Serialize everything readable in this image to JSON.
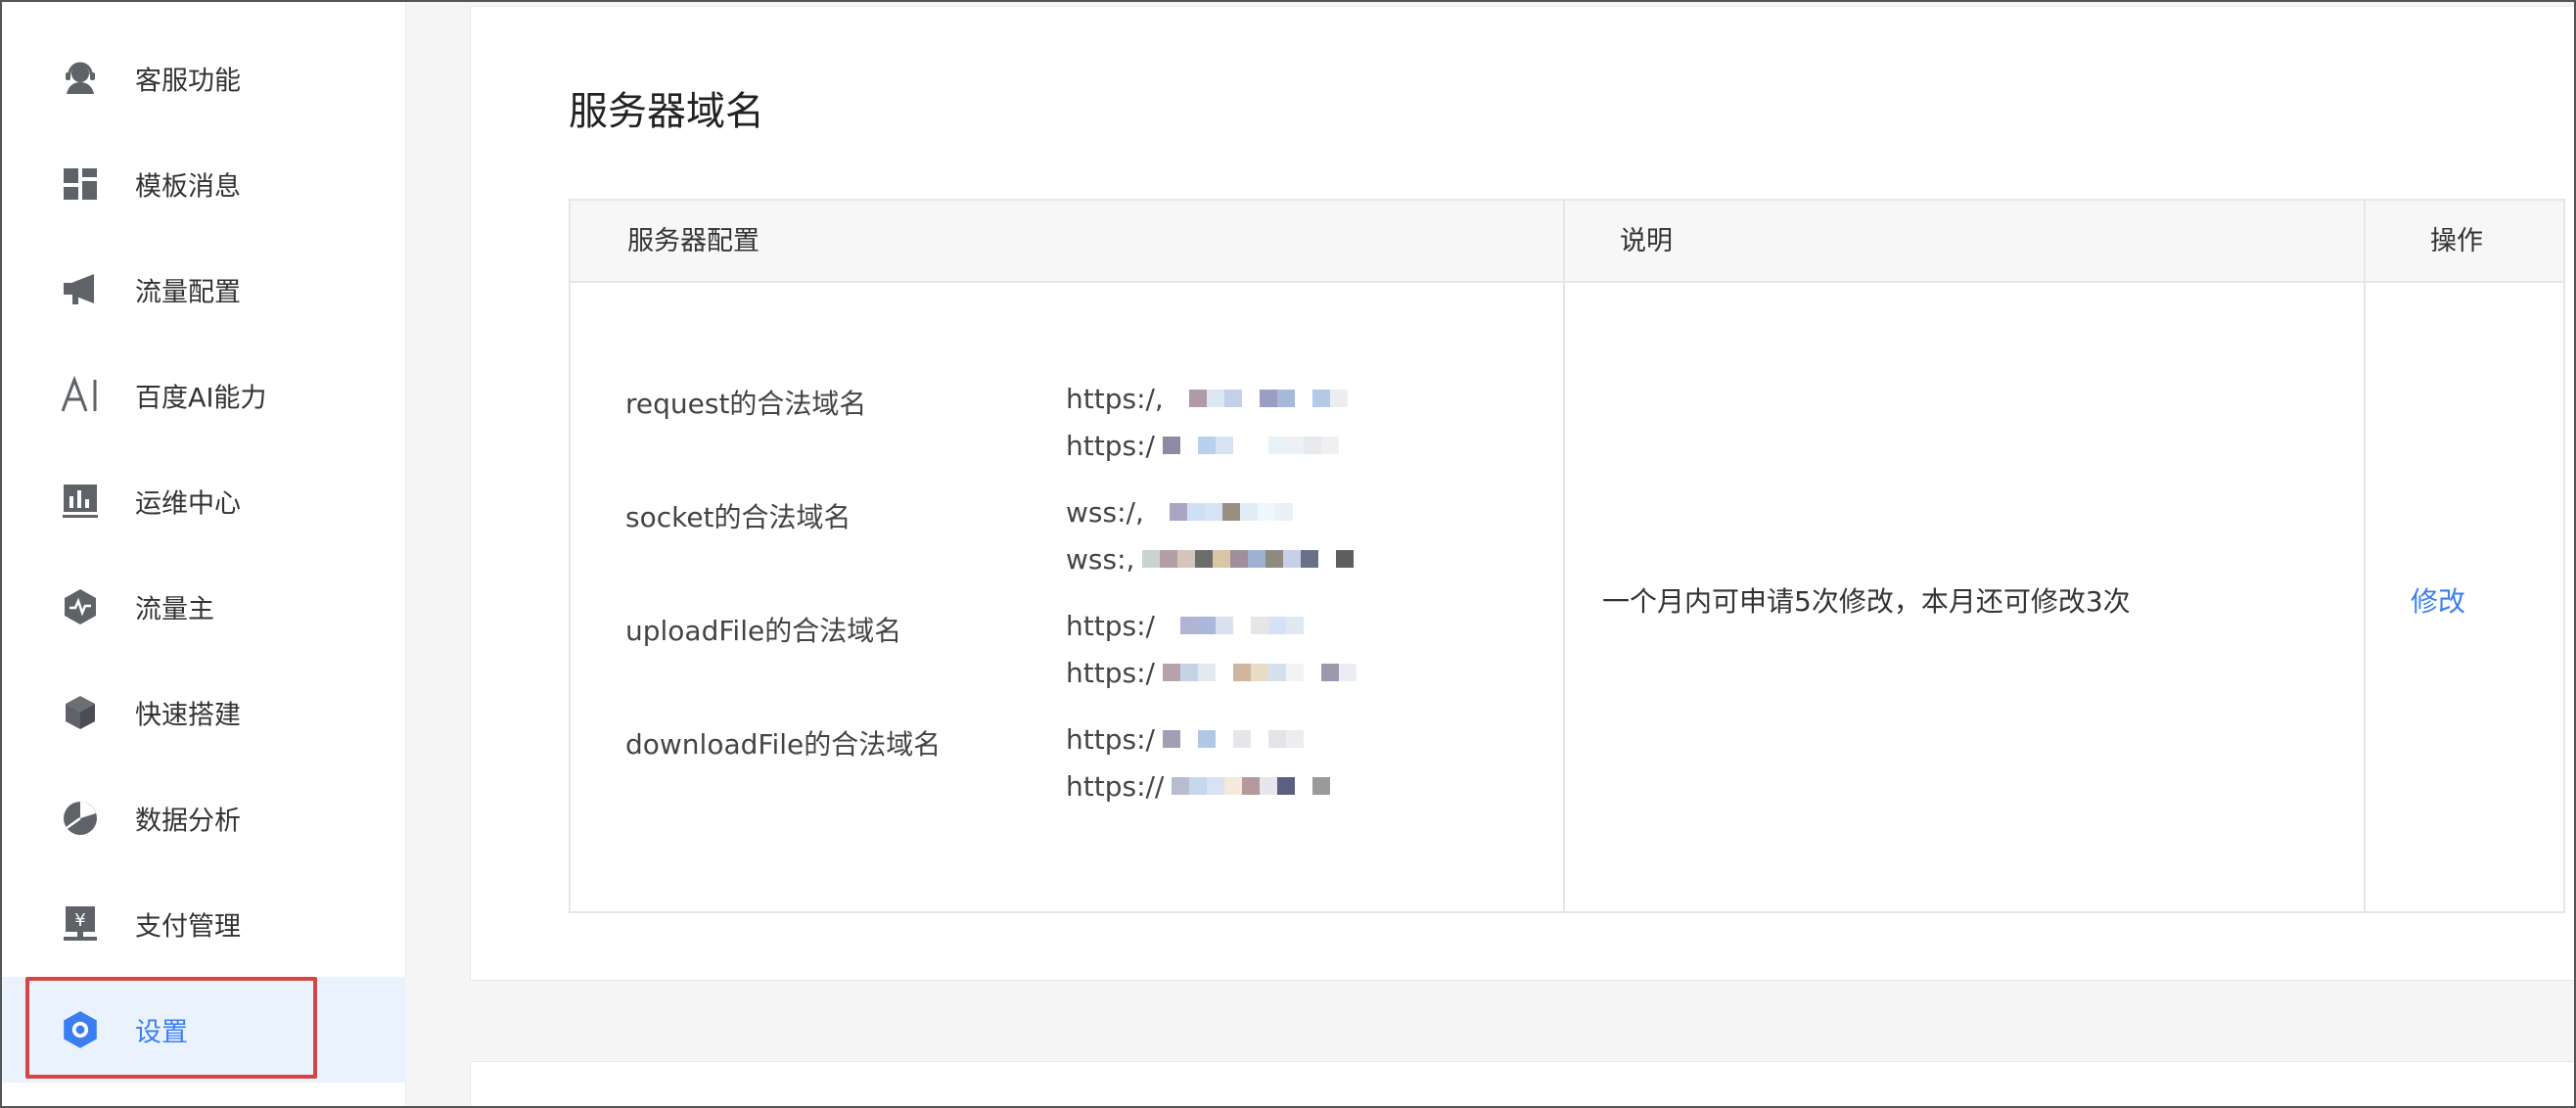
{
  "sidebar": {
    "items": [
      {
        "label": "客服功能",
        "icon": "headset-icon"
      },
      {
        "label": "模板消息",
        "icon": "template-grid-icon"
      },
      {
        "label": "流量配置",
        "icon": "megaphone-icon"
      },
      {
        "label": "百度AI能力",
        "icon": "ai-icon"
      },
      {
        "label": "运维中心",
        "icon": "bar-chart-icon"
      },
      {
        "label": "流量主",
        "icon": "hexagon-pulse-icon"
      },
      {
        "label": "快速搭建",
        "icon": "cube-icon"
      },
      {
        "label": "数据分析",
        "icon": "pie-chart-icon"
      },
      {
        "label": "支付管理",
        "icon": "yen-terminal-icon"
      },
      {
        "label": "设置",
        "icon": "settings-hexagon-icon",
        "active": true
      }
    ]
  },
  "main": {
    "title": "服务器域名",
    "table": {
      "headers": [
        "服务器配置",
        "说明",
        "操作"
      ],
      "rows": [
        {
          "label": "request的合法域名",
          "urls": [
            "https:/,",
            "https:/"
          ]
        },
        {
          "label": "socket的合法域名",
          "urls": [
            "wss:/,",
            "wss:,"
          ]
        },
        {
          "label": "uploadFile的合法域名",
          "urls": [
            "https:/",
            "https:/"
          ]
        },
        {
          "label": "downloadFile的合法域名",
          "urls": [
            "https:/",
            "https://"
          ]
        }
      ],
      "description": "一个月内可申请5次修改，本月还可修改3次",
      "action": "修改"
    }
  },
  "colors": {
    "accent": "#3a7ef2",
    "highlight_border": "#d64545",
    "active_bg": "#eaf2fd"
  }
}
